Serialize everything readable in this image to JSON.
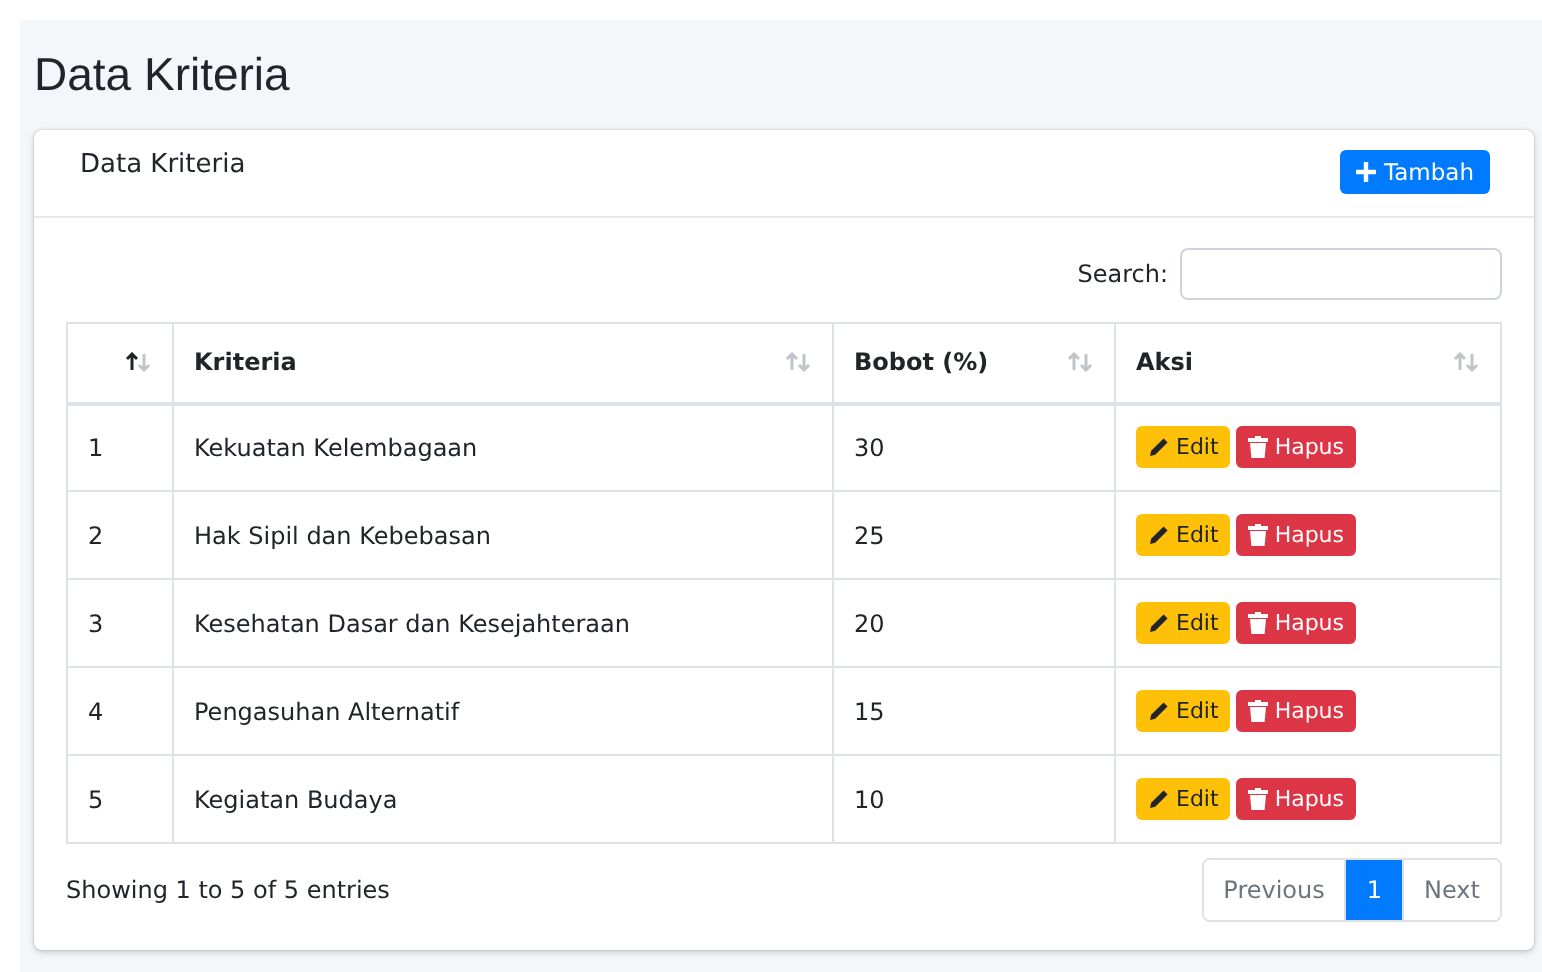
{
  "page_title": "Data Kriteria",
  "card": {
    "title": "Data Kriteria",
    "add_button": "Tambah"
  },
  "search": {
    "label": "Search:"
  },
  "table": {
    "columns": [
      {
        "sorted": true
      },
      {
        "label": "Kriteria",
        "sorted": false
      },
      {
        "label": "Bobot (%)",
        "sorted": false
      },
      {
        "label": "Aksi",
        "sorted": false
      }
    ],
    "rows": [
      {
        "no": "1",
        "kriteria": "Kekuatan Kelembagaan",
        "bobot": "30",
        "edit": "Edit",
        "delete": "Hapus"
      },
      {
        "no": "2",
        "kriteria": "Hak Sipil dan Kebebasan",
        "bobot": "25",
        "edit": "Edit",
        "delete": "Hapus"
      },
      {
        "no": "3",
        "kriteria": "Kesehatan Dasar dan Kesejahteraan",
        "bobot": "20",
        "edit": "Edit",
        "delete": "Hapus"
      },
      {
        "no": "4",
        "kriteria": "Pengasuhan Alternatif",
        "bobot": "15",
        "edit": "Edit",
        "delete": "Hapus"
      },
      {
        "no": "5",
        "kriteria": "Kegiatan Budaya",
        "bobot": "10",
        "edit": "Edit",
        "delete": "Hapus"
      }
    ]
  },
  "info": "Showing 1 to 5 of 5 entries",
  "pagination": [
    {
      "label": "Previous",
      "selected": false
    },
    {
      "label": "1",
      "selected": true
    },
    {
      "label": "Next",
      "selected": false
    }
  ]
}
